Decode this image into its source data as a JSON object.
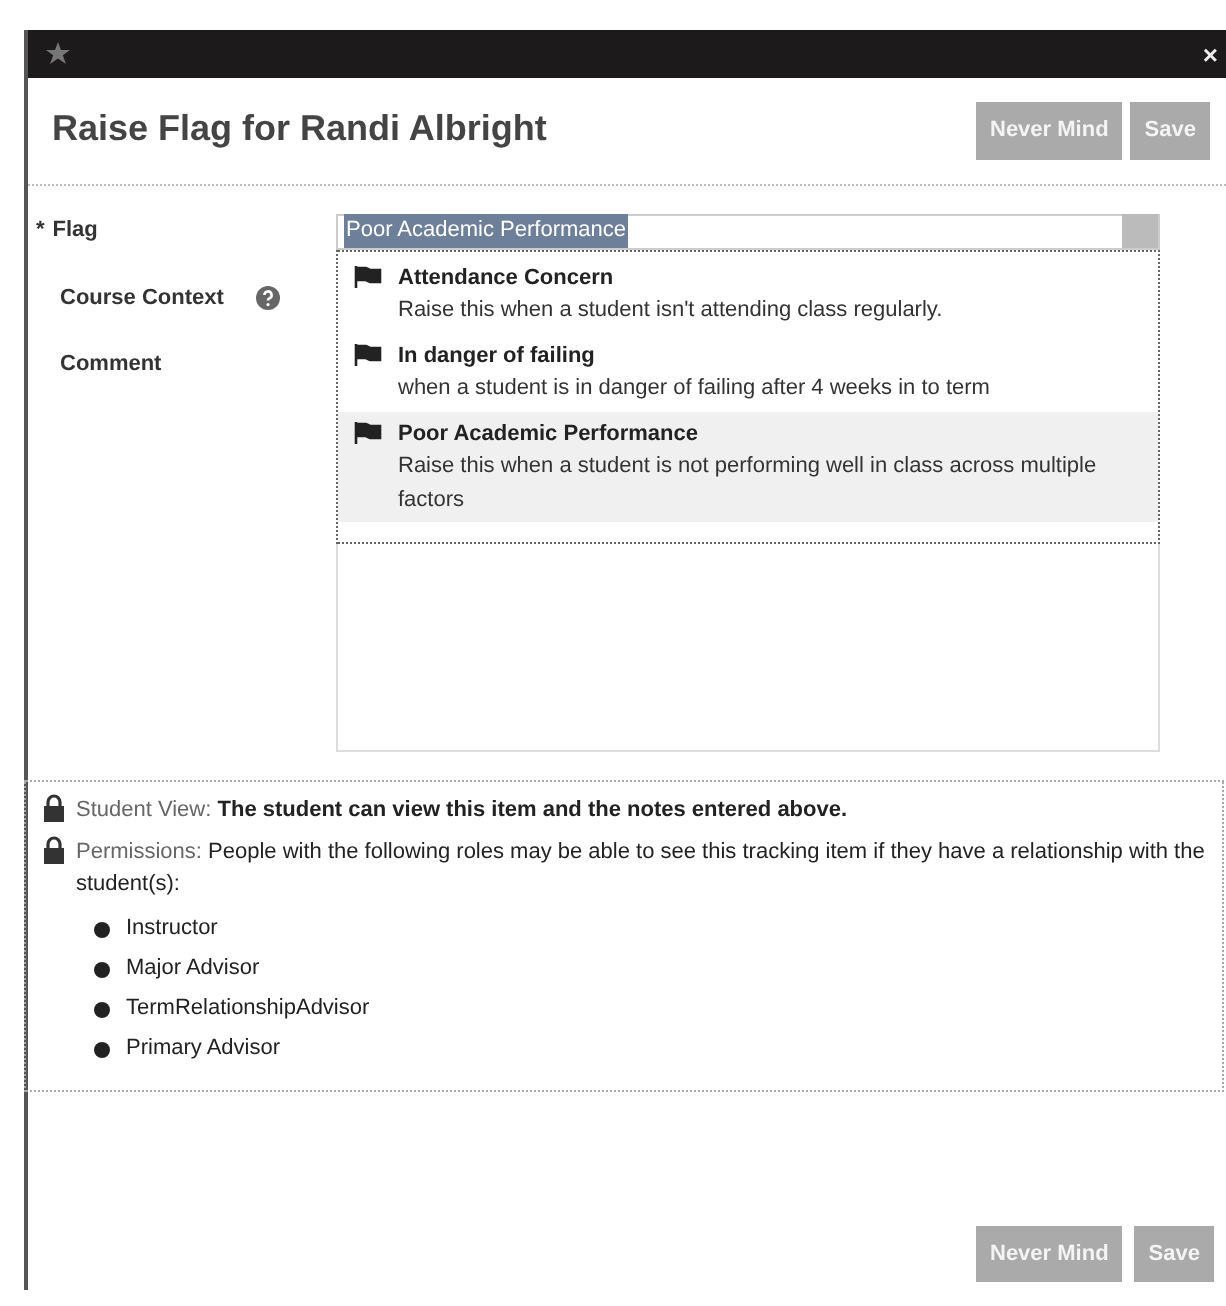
{
  "window": {
    "close": "×"
  },
  "header": {
    "title": "Raise Flag for Randi Albright",
    "buttons": [
      {
        "label": "Never Mind",
        "disabled": true
      },
      {
        "label": "Save",
        "disabled": true
      }
    ]
  },
  "form": {
    "flag": {
      "required_mark": "*",
      "label": "Flag",
      "value": "Poor Academic Performance",
      "options": [
        {
          "title": "Attendance Concern",
          "description": "Raise this when a student isn't attending class regularly.",
          "selected": false
        },
        {
          "title": "In danger of failing",
          "description": "when a student is in danger of failing after 4 weeks in to term",
          "selected": false
        },
        {
          "title": "Poor Academic Performance",
          "description": "Raise this when a student is not performing well in class across multiple factors",
          "selected": true
        }
      ]
    },
    "course_context": {
      "label": "Course Context"
    },
    "comment": {
      "label": "Comment"
    }
  },
  "visibility": {
    "student_view": {
      "label": "Student View:",
      "text": "The student can view this item and the notes entered above."
    },
    "permissions": {
      "label": "Permissions:",
      "text": "People with the following roles may be able to see this tracking item if they have a relationship with the student(s):",
      "roles": [
        "Instructor",
        "Major Advisor",
        "TermRelationshipAdvisor",
        "Primary Advisor"
      ]
    }
  },
  "footer": {
    "buttons": [
      {
        "label": "Never Mind",
        "disabled": true
      },
      {
        "label": "Save",
        "disabled": true
      }
    ]
  }
}
